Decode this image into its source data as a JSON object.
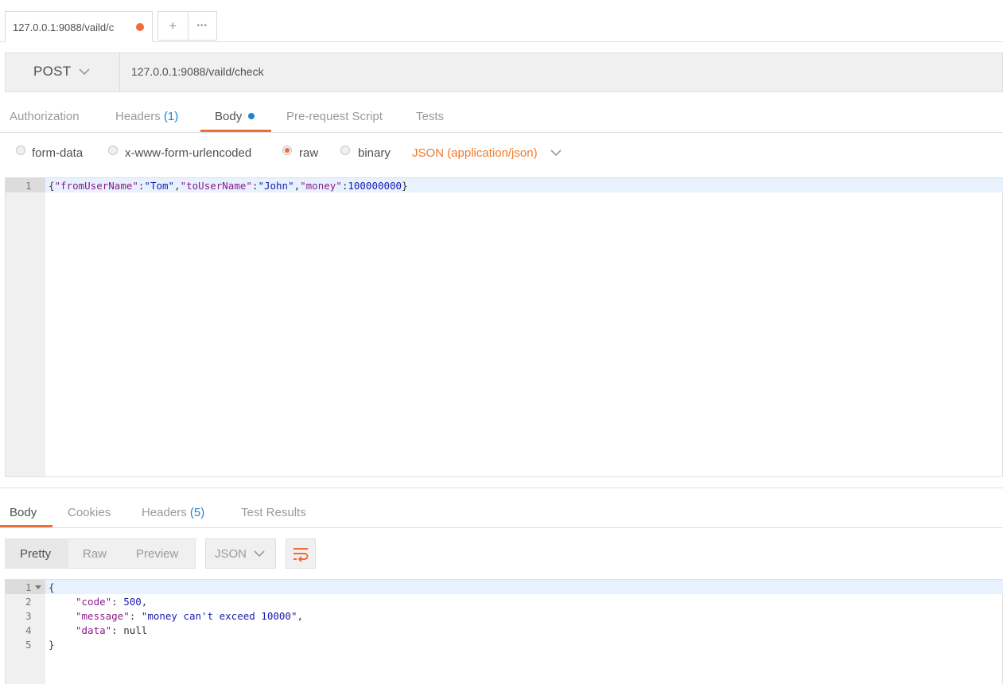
{
  "tab": {
    "title": "127.0.0.1:9088/vaild/c",
    "plus": "+",
    "more": "•••"
  },
  "request": {
    "method": "POST",
    "url": "127.0.0.1:9088/vaild/check"
  },
  "request_tabs": {
    "authorization": "Authorization",
    "headers": "Headers",
    "headers_count": "(1)",
    "body": "Body",
    "prerequest": "Pre-request Script",
    "tests": "Tests"
  },
  "body_types": {
    "form_data": "form-data",
    "urlencoded": "x-www-form-urlencoded",
    "raw": "raw",
    "binary": "binary",
    "selected": "raw",
    "content_type": "JSON (application/json)"
  },
  "request_body": {
    "line_number": "1",
    "tokens": [
      "{",
      "\"fromUserName\"",
      ":",
      "\"Tom\"",
      ",",
      "\"toUserName\"",
      ":",
      "\"John\"",
      ",",
      "\"money\"",
      ":",
      "100000000",
      "}"
    ]
  },
  "response_tabs": {
    "body": "Body",
    "cookies": "Cookies",
    "headers": "Headers",
    "headers_count": "(5)",
    "test_results": "Test Results"
  },
  "response_view": {
    "pretty": "Pretty",
    "raw": "Raw",
    "preview": "Preview",
    "format": "JSON"
  },
  "response_body": {
    "line_numbers": [
      "1",
      "2",
      "3",
      "4",
      "5"
    ],
    "open": "{",
    "code_key": "\"code\"",
    "code_val": "500",
    "message_key": "\"message\"",
    "message_val": "\"money can't exceed 10000\"",
    "data_key": "\"data\"",
    "data_val": "null",
    "close": "}"
  },
  "colors": {
    "accent": "#f26b3a",
    "link": "#1a85d6",
    "json_type": "#f07a2a"
  }
}
